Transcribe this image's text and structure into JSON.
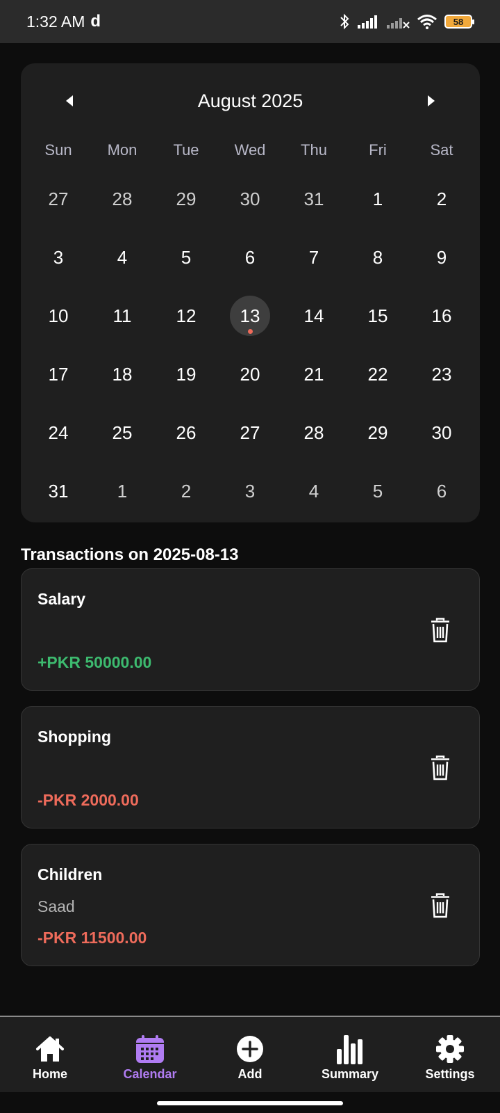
{
  "status_bar": {
    "time": "1:32 AM",
    "app_glyph": "d",
    "battery": "58"
  },
  "calendar": {
    "title": "August 2025",
    "weekdays": [
      "Sun",
      "Mon",
      "Tue",
      "Wed",
      "Thu",
      "Fri",
      "Sat"
    ],
    "weeks": [
      [
        "27",
        "28",
        "29",
        "30",
        "31",
        "1",
        "2"
      ],
      [
        "3",
        "4",
        "5",
        "6",
        "7",
        "8",
        "9"
      ],
      [
        "10",
        "11",
        "12",
        "13",
        "14",
        "15",
        "16"
      ],
      [
        "17",
        "18",
        "19",
        "20",
        "21",
        "22",
        "23"
      ],
      [
        "24",
        "25",
        "26",
        "27",
        "28",
        "29",
        "30"
      ],
      [
        "31",
        "1",
        "2",
        "3",
        "4",
        "5",
        "6"
      ]
    ],
    "selected_day": "13",
    "event_days": [
      "13"
    ]
  },
  "transactions": {
    "heading": "Transactions on 2025-08-13",
    "items": [
      {
        "category": "Salary",
        "note": "",
        "amount": "+PKR 50000.00",
        "type": "income"
      },
      {
        "category": "Shopping",
        "note": "",
        "amount": "-PKR 2000.00",
        "type": "expense"
      },
      {
        "category": "Children",
        "note": "Saad",
        "amount": "-PKR 11500.00",
        "type": "expense"
      }
    ]
  },
  "bottom_nav": {
    "items": [
      {
        "label": "Home",
        "icon": "home-icon"
      },
      {
        "label": "Calendar",
        "icon": "calendar-icon",
        "active": true
      },
      {
        "label": "Add",
        "icon": "add-circle-icon"
      },
      {
        "label": "Summary",
        "icon": "bar-chart-icon"
      },
      {
        "label": "Settings",
        "icon": "gear-icon"
      }
    ]
  },
  "colors": {
    "accent": "#b07cf2",
    "income": "#3dba6f",
    "expense": "#ee6b5b",
    "card": "#1f1f1f",
    "background": "#0d0d0d"
  }
}
